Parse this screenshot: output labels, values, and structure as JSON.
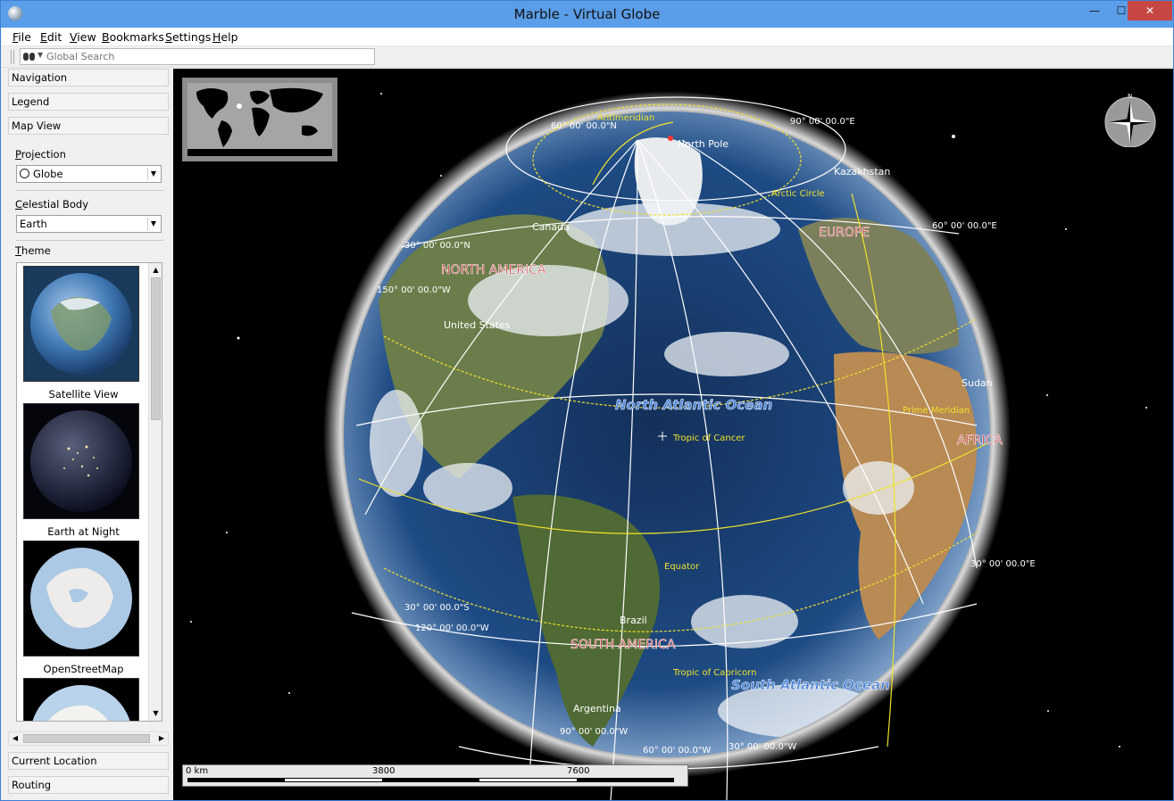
{
  "window": {
    "title": "Marble - Virtual Globe",
    "minimize": "—",
    "maximize": "☐",
    "close": "✕"
  },
  "menu": [
    "File",
    "Edit",
    "View",
    "Bookmarks",
    "Settings",
    "Help"
  ],
  "search": {
    "placeholder": "Global Search"
  },
  "panel": {
    "navigation": "Navigation",
    "legend": "Legend",
    "map_view": "Map View",
    "projection_label": "Projection",
    "projection_value": "Globe",
    "celestial_label": "Celestial Body",
    "celestial_value": "Earth",
    "theme_label": "Theme",
    "themes": [
      "Satellite View",
      "Earth at Night",
      "OpenStreetMap"
    ],
    "current_location": "Current Location",
    "routing": "Routing"
  },
  "map": {
    "compass_letter": "N",
    "grid_labels": [
      "90° 00' 00.0\"E",
      "60° 00' 00.0\"N",
      "60° 00' 00.0\"E",
      "30° 00' 00.0\"N",
      "150° 00' 00.0\"W",
      "30° 00' 00.0\"E",
      "30° 00' 00.0\"S",
      "120° 00' 00.0\"W",
      "90° 00' 00.0\"W",
      "60° 00' 00.0\"W",
      "30° 00' 00.0\"W"
    ],
    "special_lines": [
      "Antimeridian",
      "Arctic Circle",
      "Prime Meridian",
      "Tropic of Cancer",
      "Equator",
      "Tropic of Capricorn"
    ],
    "continents": [
      "NORTH AMERICA",
      "EUROPE",
      "AFRICA",
      "SOUTH AMERICA"
    ],
    "oceans": [
      "North Atlantic Ocean",
      "South Atlantic Ocean"
    ],
    "places": [
      "North Pole",
      "Kazakhstan",
      "Canada",
      "United States",
      "Sudan",
      "Brazil",
      "Argentina"
    ],
    "scale": [
      "0 km",
      "3800",
      "7600"
    ]
  },
  "colors": {
    "titlebar": "#5a9de8",
    "continent_label": "#c2131b",
    "ocean_label": "#4e86d8",
    "grid_special": "#f0e22b",
    "close_button": "#c74743"
  }
}
